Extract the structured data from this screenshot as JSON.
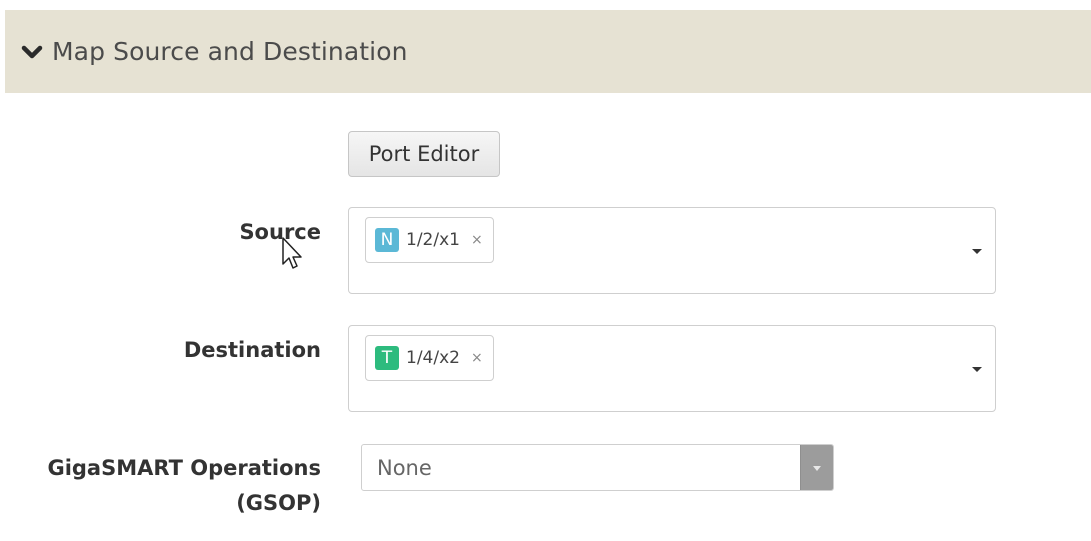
{
  "section": {
    "title": "Map Source and Destination",
    "toggle_icon": "chevron-down-icon"
  },
  "port_editor_button": "Port Editor",
  "source": {
    "label": "Source",
    "tags": [
      {
        "badge": "N",
        "badge_color": "#5bb8d6",
        "value": "1/2/x1",
        "remove": "×"
      }
    ]
  },
  "destination": {
    "label": "Destination",
    "tags": [
      {
        "badge": "T",
        "badge_color": "#2dbb7e",
        "value": "1/4/x2",
        "remove": "×"
      }
    ]
  },
  "gsop": {
    "label_line1": "GigaSMART Operations",
    "label_line2": "(GSOP)",
    "selected": "None"
  },
  "colors": {
    "header_bg": "#e6e2d3"
  }
}
